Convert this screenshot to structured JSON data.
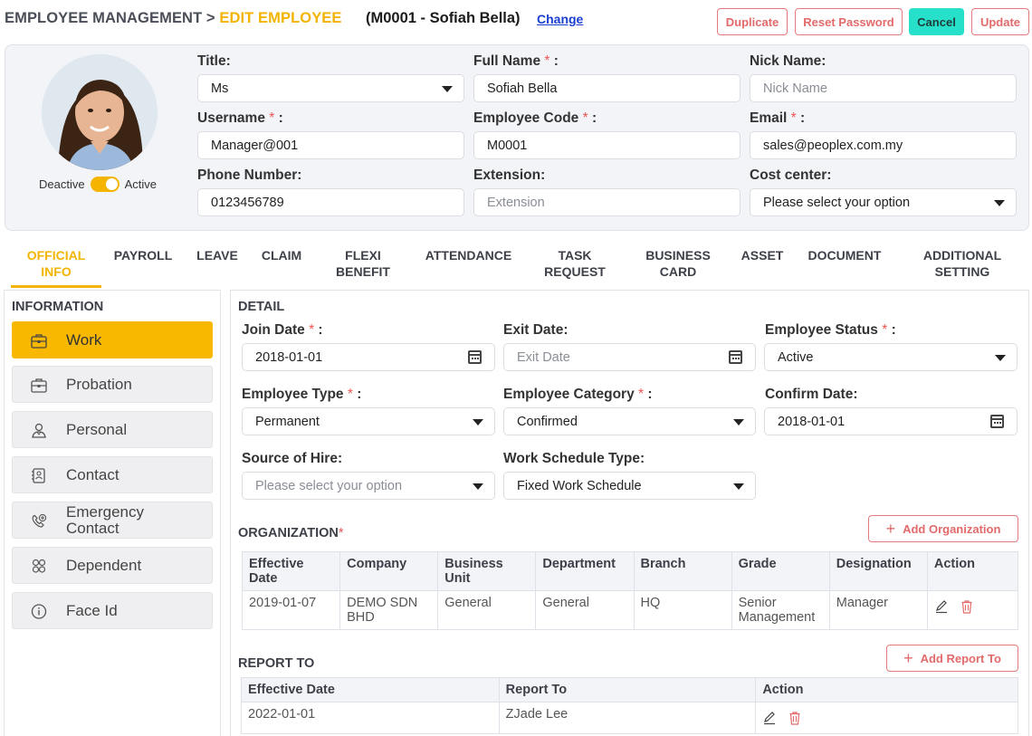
{
  "header": {
    "breadcrumb_root": "EMPLOYEE MANAGEMENT >",
    "breadcrumb_current": "EDIT EMPLOYEE",
    "employee_id": "(M0001 - Sofiah Bella)",
    "change_link": "Change",
    "buttons": {
      "duplicate": "Duplicate",
      "reset_password": "Reset Password",
      "cancel": "Cancel",
      "update": "Update"
    }
  },
  "profile": {
    "toggle_off_label": "Deactive",
    "toggle_on_label": "Active",
    "status_active": true,
    "fields": {
      "title": {
        "label": "Title:",
        "value": "Ms"
      },
      "full_name": {
        "label": "Full Name",
        "value": "Sofiah Bella"
      },
      "nick_name": {
        "label": "Nick Name:",
        "placeholder": "Nick Name"
      },
      "username": {
        "label": "Username",
        "value": "Manager@001"
      },
      "employee_code": {
        "label": "Employee Code",
        "value": "M0001"
      },
      "email": {
        "label": "Email",
        "value": "sales@peoplex.com.my"
      },
      "phone": {
        "label": "Phone Number:",
        "value": "0123456789"
      },
      "extension": {
        "label": "Extension:",
        "placeholder": "Extension"
      },
      "cost_center": {
        "label": "Cost center:",
        "value": "Please select your option"
      }
    },
    "required_mark": "*",
    "colon": " :"
  },
  "tabs": [
    {
      "label": "OFFICIAL\nINFO",
      "active": true
    },
    {
      "label": "PAYROLL"
    },
    {
      "label": "LEAVE"
    },
    {
      "label": "CLAIM"
    },
    {
      "label": "FLEXI\nBENEFIT"
    },
    {
      "label": "ATTENDANCE"
    },
    {
      "label": "TASK\nREQUEST"
    },
    {
      "label": "BUSINESS\nCARD"
    },
    {
      "label": "ASSET"
    },
    {
      "label": "DOCUMENT"
    },
    {
      "label": "ADDITIONAL\nSETTING"
    }
  ],
  "sidebar": {
    "heading": "INFORMATION",
    "items": [
      {
        "label": "Work",
        "icon": "briefcase-icon",
        "active": true
      },
      {
        "label": "Probation",
        "icon": "briefcase-icon"
      },
      {
        "label": "Personal",
        "icon": "person-icon"
      },
      {
        "label": "Contact",
        "icon": "contact-card-icon"
      },
      {
        "label": "Emergency\nContact",
        "icon": "emergency-phone-icon"
      },
      {
        "label": "Dependent",
        "icon": "dependent-icon"
      },
      {
        "label": "Face Id",
        "icon": "info-icon"
      }
    ]
  },
  "detail": {
    "heading": "DETAIL",
    "join_date": {
      "label": "Join Date",
      "value": "2018-01-01"
    },
    "exit_date": {
      "label": "Exit Date:",
      "placeholder": "Exit Date"
    },
    "employee_status": {
      "label": "Employee Status",
      "value": "Active"
    },
    "employee_type": {
      "label": "Employee Type",
      "value": "Permanent"
    },
    "employee_category": {
      "label": "Employee Category",
      "value": "Confirmed"
    },
    "confirm_date": {
      "label": "Confirm Date:",
      "value": "2018-01-01"
    },
    "source_of_hire": {
      "label": "Source of Hire:",
      "placeholder": "Please select your option"
    },
    "work_schedule_type": {
      "label": "Work Schedule Type:",
      "value": "Fixed Work Schedule"
    }
  },
  "organization": {
    "heading": "ORGANIZATION",
    "required_mark": "*",
    "add_label": "Add Organization",
    "columns": [
      "Effective\nDate",
      "Company",
      "Business\nUnit",
      "Department",
      "Branch",
      "Grade",
      "Designation",
      "Action"
    ],
    "rows": [
      [
        "2019-01-07",
        "DEMO SDN\nBHD",
        "General",
        "General",
        "HQ",
        "Senior\nManagement",
        "Manager"
      ]
    ]
  },
  "report_to": {
    "heading": "REPORT TO",
    "add_label": "Add Report To",
    "columns": [
      "Effective Date",
      "Report To",
      "Action"
    ],
    "rows": [
      [
        "2022-01-01",
        "ZJade Lee"
      ]
    ]
  },
  "colors": {
    "accent": "#f3b300",
    "danger": "#e26a6a",
    "cancel_bg": "#27e0c9",
    "link": "#1a3fd1"
  }
}
